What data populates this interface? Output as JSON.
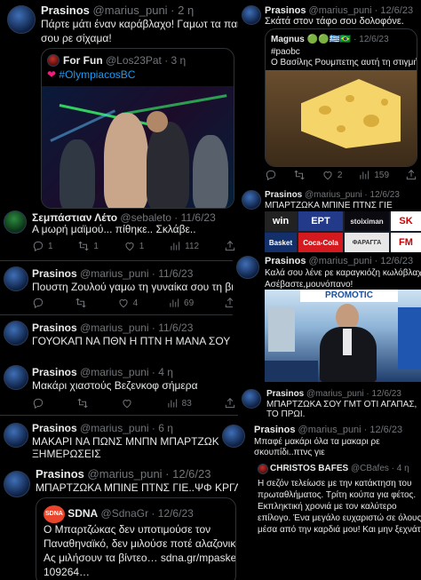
{
  "left": {
    "t1": {
      "name": "Prasinos",
      "handle": "@marius_puni · 2 η",
      "text1": "Πάρτε μάτι έναν καράβλαχο! Γαμωτ τα παιδιά",
      "text2": "σου ρε σίχαμα!",
      "quote": {
        "name": "For Fun",
        "handle": "@Los23Pat · 3 η",
        "text": "#OlympiacosBC"
      }
    },
    "t2": {
      "name": "Σεμπάστιαν Λέτο",
      "handle": "@sebaleto · 11/6/23",
      "text": "Α μωρή μαϊμού... πίθηκε.. Σκλάβε..",
      "replies": "1",
      "retweets": "1",
      "likes": "1",
      "views": "112"
    },
    "t3": {
      "name": "Prasinos",
      "handle": "@marius_puni · 11/6/23",
      "text": "Πουστη Ζουλού γαμω τη γυναίκα σου τη βιζιτ",
      "likes": "4",
      "views": "69"
    },
    "t4": {
      "name": "Prasinos",
      "handle": "@marius_puni · 11/6/23",
      "text": "ΓΟΥΟΚΑΠ ΝΑ ΠΘΝ Η ΠΤΝ Η ΜΑΝΑ ΣΟΥ ΤΩ"
    },
    "t5": {
      "name": "Prasinos",
      "handle": "@marius_puni · 4 η",
      "text": "Μακάρι χιαστούς Βεζενκοφ σήμερα",
      "views": "83"
    },
    "t6": {
      "name": "Prasinos",
      "handle": "@marius_puni · 6 η",
      "text1": "ΜΑΚΑΡΙ ΝΑ ΠΩΝΣ ΜΝΠΝ ΜΠΑΡΤΖΩΚΑ,Μ",
      "text2": "ΞΗΜΕΡΩΣΕΙΣ"
    },
    "t7": {
      "name": "Prasinos",
      "handle": "@marius_puni · 12/6/23",
      "text": "ΜΠΑΡΤΖΩΚΑ ΜΠΙΝΕ ΠΤΝΣ ΓΙΕ..ΨΦ ΚΡΓΛ ΨΦ",
      "quote": {
        "badge": "SDNA",
        "name": "SDNA",
        "handle": "@SdnaGr · 12/6/23",
        "line1": "Ο Μπαρτζώκας δεν υποτιμούσε τον",
        "line2": "Παναθηναϊκό, δεν μιλούσε ποτέ αλαζονικά:",
        "line3": "Ας μιλήσουν τα βίντεο… sdna.gr/mpasket/",
        "line4": "109264…"
      }
    }
  },
  "right": {
    "t1": {
      "name": "Prasinos",
      "handle": "@marius_puni · 12/6/23",
      "text": "Σκάτά στον τάφο σου δολοφόνε.",
      "quote": {
        "name": "Magnus",
        "handle": "· 12/6/23",
        "tag": "#paobc",
        "text": "Ο Βασίλης Ρουμπετης αυτή τη στιγμή 👽"
      },
      "retweets": "2",
      "views": "159"
    },
    "t2": {
      "name": "Prasinos",
      "handle": "@marius_puni · 12/6/23",
      "text": "ΜΠΑΡΤΖΩΚΑ ΜΠΙΝΕ ΠΤΝΣ ΓΙΕ",
      "signs": [
        "win",
        "ΕΡΤ",
        "stoiximan",
        "SK",
        "Basket",
        "Coca-Cola",
        "ΦΑΡΑΓΓΑ",
        "FM"
      ]
    },
    "t3": {
      "name": "Prasinos",
      "handle": "@marius_puni · 12/6/23",
      "text1": "Καλά σου λένε ρε καραγκιόζη κωλόβλαχε!",
      "text2": "Ασέβαστε,μουνόπανο!",
      "banner": "PROMOTIC"
    },
    "t4": {
      "name": "Prasinos",
      "handle": "@marius_puni · 12/6/23",
      "text1": "ΜΠΑΡΤΖΩΚΑ ΣΟΥ ΓΜΤ ΟΤΙ ΑΓΑΠΑΣ,",
      "text2": "ΤΟ ΠΡΩΙ."
    },
    "t5": {
      "name": "Prasinos",
      "handle": "@marius_puni · 12/6/23",
      "text1": "Μπαφέ μακάρι όλα τα μακαρι ρε",
      "text2": "σκουπίδι..πτνς γιε"
    },
    "t6": {
      "name": "CHRISTOS BAFES",
      "handle": "@CBafes · 4 η",
      "line1": "Η σεζόν τελείωσε με την κατάκτηση του",
      "line2": "πρωταθλήματος. Τρίτη κούπα για φέτος.",
      "line3": "Εκπληκτική χρονιά με τον καλύτερο",
      "line4": "επίλογο. Ένα μεγάλο ευχαριστώ σε όλους",
      "line5": "μέσα από την καρδιά μου! Και μην ξεχνάτ..."
    }
  },
  "colors": {
    "bg": "#000000",
    "text": "#e7e9ea",
    "muted": "#71767b",
    "border": "#2f3336",
    "like": "#f91880"
  }
}
